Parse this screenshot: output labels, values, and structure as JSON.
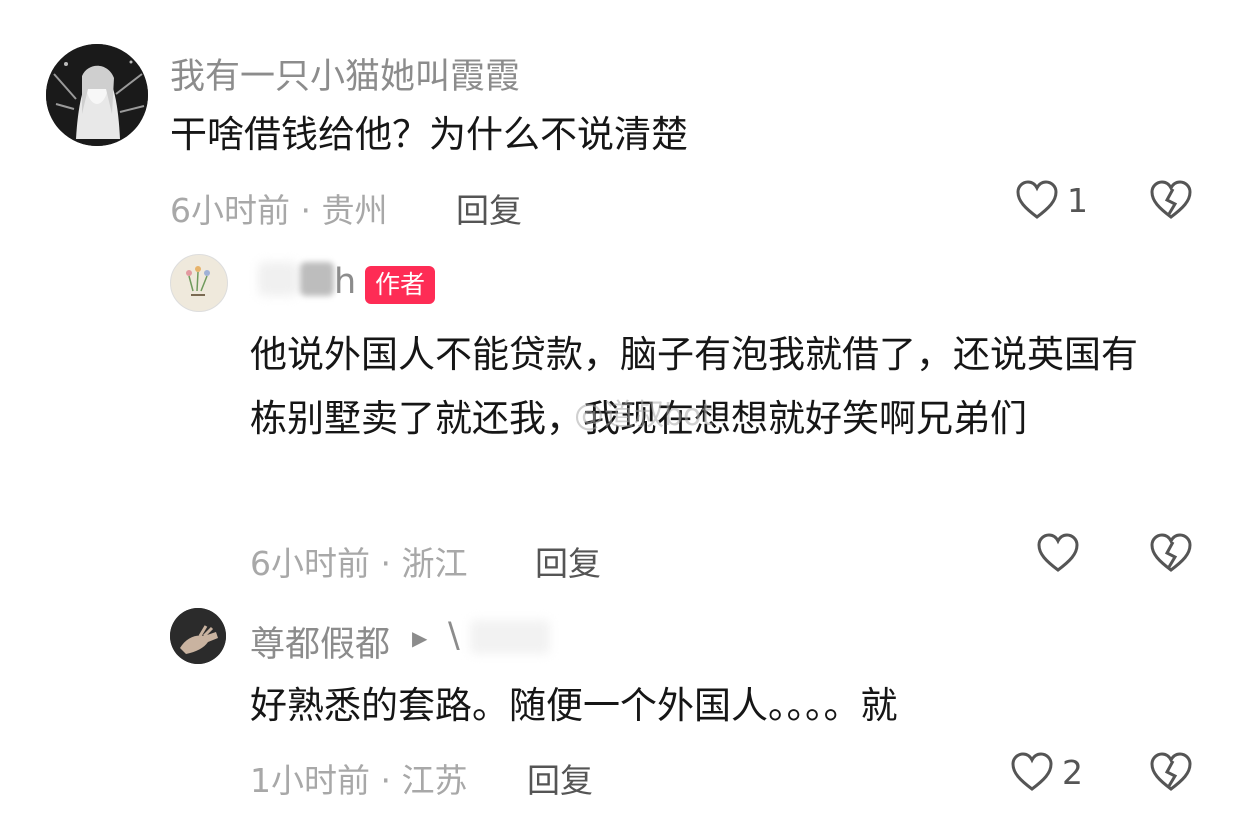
{
  "comments": [
    {
      "username": "我有一只小猫她叫霞霞",
      "text": "干啥借钱给他？为什么不说清楚",
      "time": "6小时前",
      "location": "贵州",
      "reply_label": "回复",
      "like_count": "1",
      "avatar_icon": "anime-girl-avatar"
    },
    {
      "username": "h",
      "author_badge": "作者",
      "text": "他说外国人不能贷款，脑子有泡我就借了，还说英国有栋别墅卖了就还我，我现在想想就好笑啊兄弟们",
      "time": "6小时前",
      "location": "浙江",
      "reply_label": "回复",
      "like_count": "",
      "avatar_icon": "flower-plate-avatar"
    },
    {
      "username": "尊都假都",
      "reply_target": "\\",
      "text": "好熟悉的套路。随便一个外国人。。。。就",
      "time": "1小时前",
      "location": "江苏",
      "reply_label": "回复",
      "like_count": "2",
      "avatar_icon": "hand-photo-avatar"
    }
  ],
  "meta_separator": "·",
  "watermark": "@道叔bot",
  "colors": {
    "badge": "#fe2c55",
    "meta": "#a8a8a8",
    "username": "#8c8c8c",
    "text": "#161616"
  }
}
